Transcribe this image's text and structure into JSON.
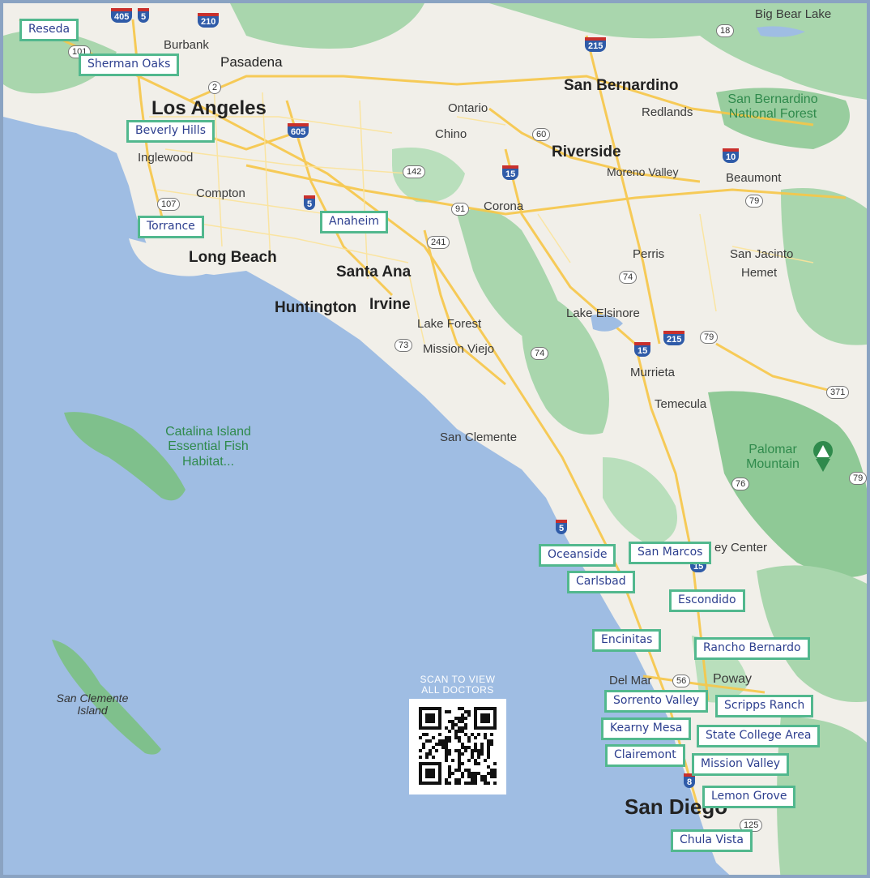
{
  "region_labels": {
    "big_cities": [
      "Los Angeles",
      "San Bernardino",
      "Riverside",
      "Long Beach",
      "Santa Ana",
      "Huntington",
      "Irvine",
      "San Diego"
    ],
    "cities": [
      "Burbank",
      "Pasadena",
      "Big Bear Lake",
      "Ontario",
      "Redlands",
      "Chino",
      "Inglewood",
      "Moreno Valley",
      "Beaumont",
      "Compton",
      "Corona",
      "Perris",
      "San Jacinto",
      "Hemet",
      "Lake Elsinore",
      "Lake Forest",
      "Mission Viejo",
      "Murrieta",
      "Temecula",
      "San Clemente",
      "ey Center",
      "Del Mar",
      "Poway"
    ],
    "green_areas": [
      "San Bernardino National Forest",
      "Catalina Island Essential Fish Habitat...",
      "Palomar Mountain"
    ],
    "islands": [
      "San Clemente Island"
    ]
  },
  "service_areas": [
    "Reseda",
    "Sherman Oaks",
    "Beverly Hills",
    "Torrance",
    "Anaheim",
    "Oceanside",
    "San Marcos",
    "Carlsbad",
    "Escondido",
    "Encinitas",
    "Rancho Bernardo",
    "Sorrento Valley",
    "Scripps Ranch",
    "Kearny Mesa",
    "State College Area",
    "Clairemont",
    "Mission Valley",
    "Lemon Grove",
    "Chula Vista"
  ],
  "routes": [
    "405",
    "5",
    "210",
    "101",
    "2",
    "215",
    "18",
    "605",
    "60",
    "10",
    "142",
    "15",
    "107",
    "5",
    "91",
    "79",
    "241",
    "74",
    "73",
    "74",
    "15",
    "215",
    "79",
    "371",
    "5",
    "76",
    "79",
    "15",
    "56",
    "8",
    "125"
  ],
  "qr": {
    "caption_line1": "SCAN TO VIEW",
    "caption_line2": "ALL DOCTORS"
  },
  "colors": {
    "ocean": "#9fbde3",
    "land": "#f1efe9",
    "park": "#9dd1a4",
    "highway": "#f7c748",
    "tag_border": "#52b88e",
    "tag_text": "#2d3f8f"
  }
}
